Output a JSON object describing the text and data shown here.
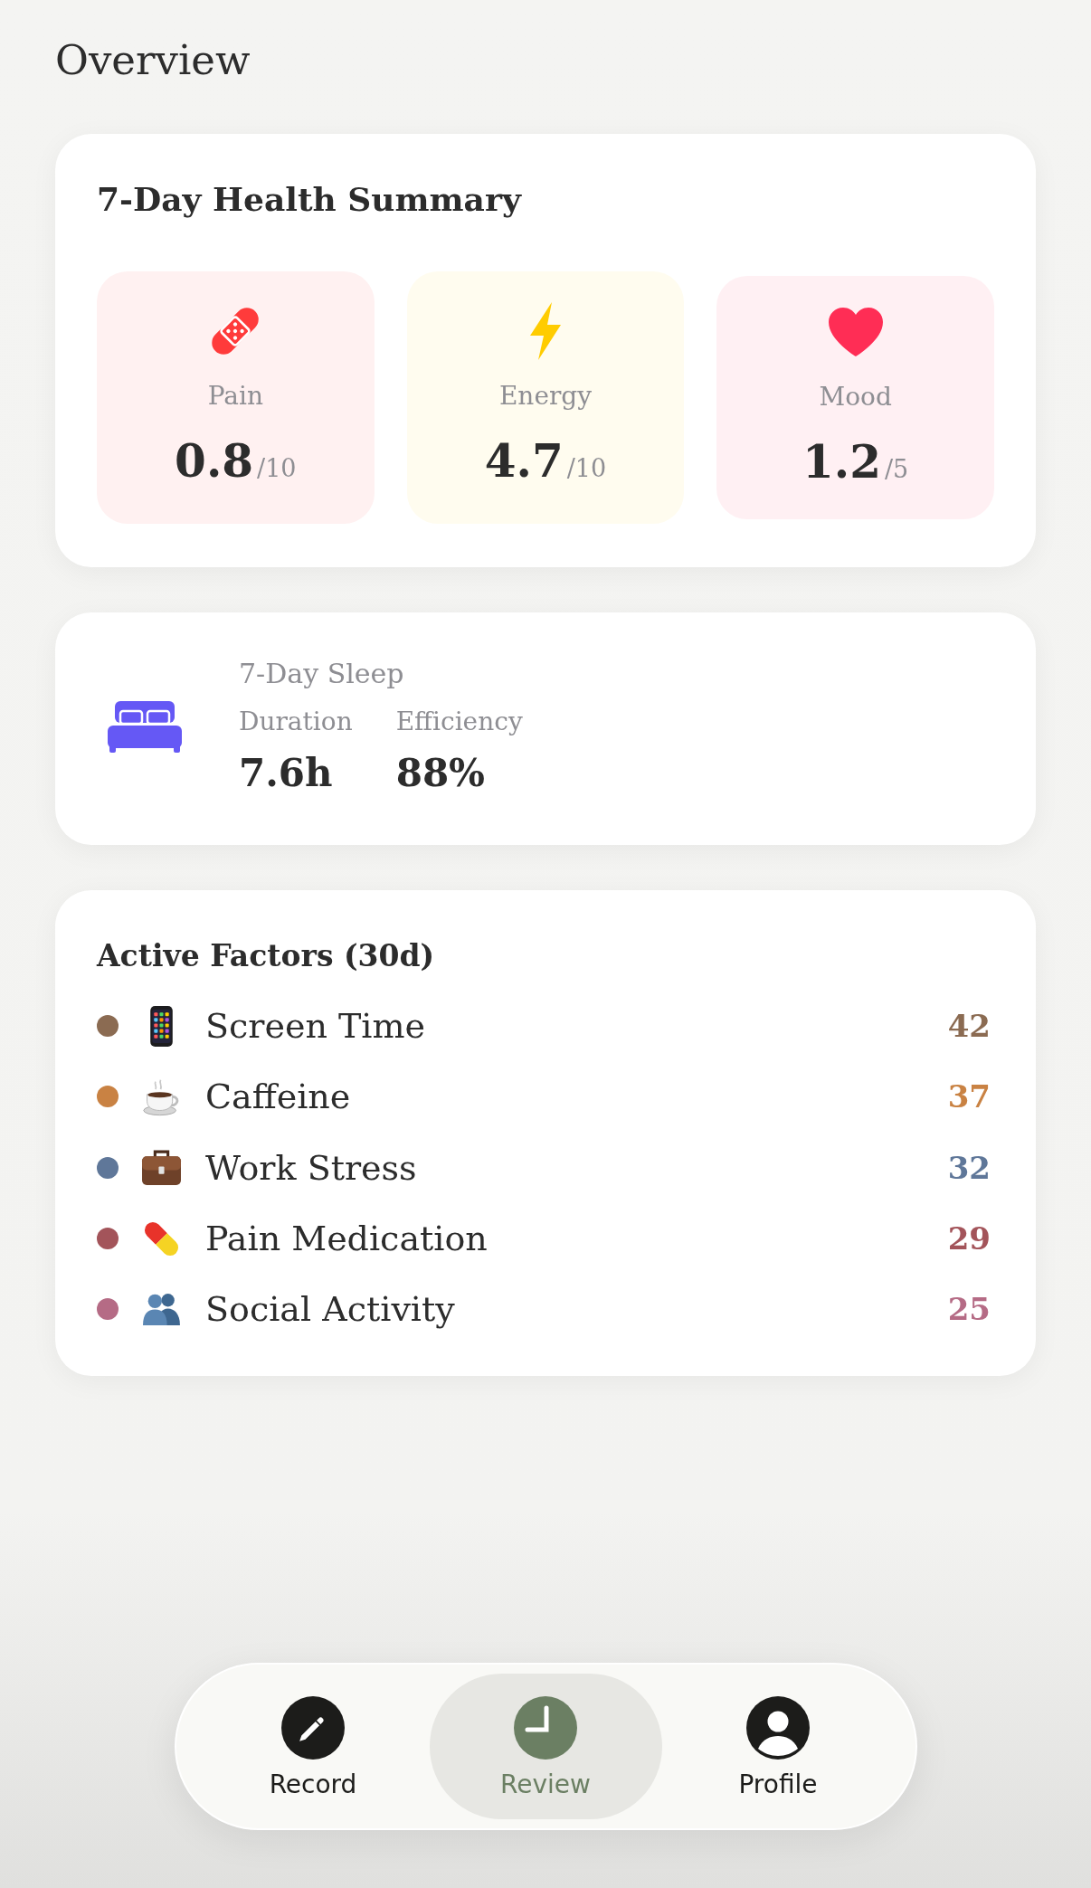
{
  "screen": {
    "title": "Overview"
  },
  "health_summary": {
    "title": "7-Day Health Summary",
    "metrics": [
      {
        "kind": "bandage",
        "label": "Pain",
        "value": "0.8",
        "scale": "/10"
      },
      {
        "kind": "bolt",
        "label": "Energy",
        "value": "4.7",
        "scale": "/10"
      },
      {
        "kind": "heart",
        "label": "Mood",
        "value": "1.2",
        "scale": "/5"
      }
    ]
  },
  "sleep": {
    "title": "7-Day Sleep",
    "stats": [
      {
        "label": "Duration",
        "value": "7.6h"
      },
      {
        "label": "Efficiency",
        "value": "88%"
      }
    ]
  },
  "active_factors": {
    "title": "Active Factors (30d)",
    "items": [
      {
        "kind": "phone",
        "name": "Screen Time",
        "count": "42",
        "color": "#8b6b52"
      },
      {
        "kind": "coffee",
        "name": "Caffeine",
        "count": "37",
        "color": "#c98243"
      },
      {
        "kind": "briefcase",
        "name": "Work Stress",
        "count": "32",
        "color": "#5f7799"
      },
      {
        "kind": "pill",
        "name": "Pain Medication",
        "count": "29",
        "color": "#a3545a"
      },
      {
        "kind": "people",
        "name": "Social Activity",
        "count": "25",
        "color": "#b56b85"
      }
    ]
  },
  "tab_bar": {
    "tabs": [
      {
        "kind": "pencil",
        "label": "Record",
        "selected": false
      },
      {
        "kind": "clock",
        "label": "Review",
        "selected": true
      },
      {
        "kind": "person",
        "label": "Profile",
        "selected": false
      }
    ]
  }
}
